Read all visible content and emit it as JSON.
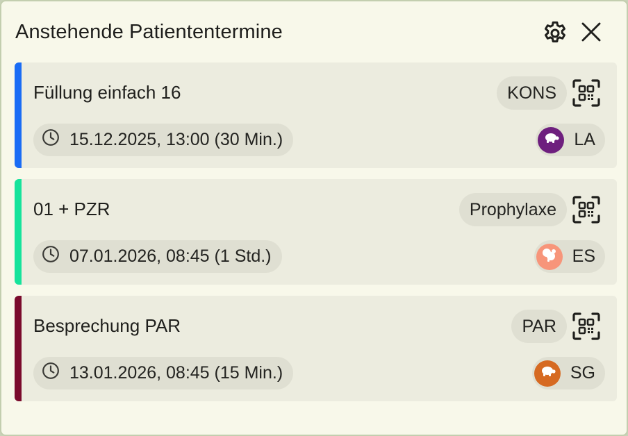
{
  "header": {
    "title": "Anstehende Patiententermine",
    "settings_icon": "gear-icon",
    "close_icon": "close-icon"
  },
  "appointments": [
    {
      "title": "Füllung einfach 16",
      "category": "KONS",
      "datetime": "15.12.2025, 13:00 (30 Min.)",
      "staff": "LA",
      "accent_color": "#1a6cf5",
      "avatar_color": "#6e1f7e",
      "avatar_icon": "turtle-icon"
    },
    {
      "title": "01 + PZR",
      "category": "Prophylaxe",
      "datetime": "07.01.2026, 08:45 (1 Std.)",
      "staff": "ES",
      "accent_color": "#16e39b",
      "avatar_color": "#f7957a",
      "avatar_icon": "squirrel-icon"
    },
    {
      "title": "Besprechung PAR",
      "category": "PAR",
      "datetime": "13.01.2026, 08:45 (15 Min.)",
      "staff": "SG",
      "accent_color": "#7a0a2c",
      "avatar_color": "#d66a22",
      "avatar_icon": "turtle-icon"
    }
  ],
  "icons": {
    "qr": "qr-code-icon",
    "clock": "clock-icon"
  }
}
